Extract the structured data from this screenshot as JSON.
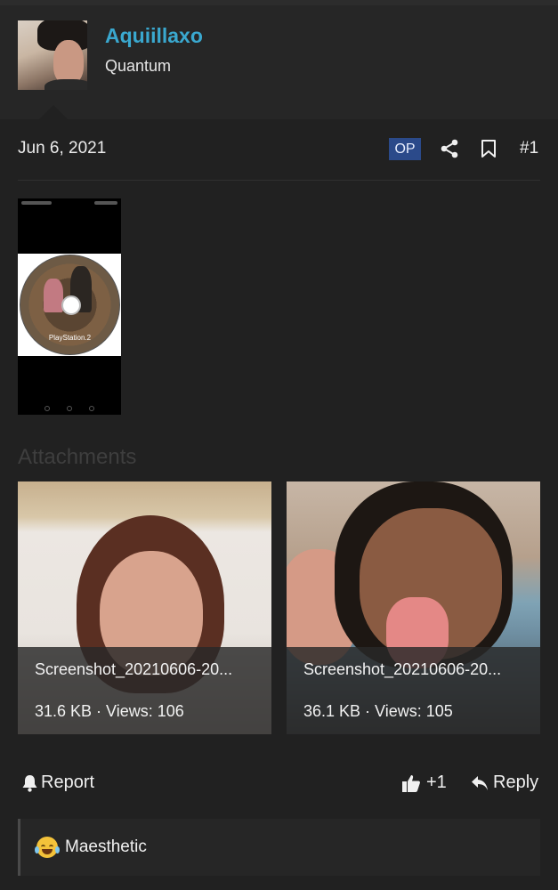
{
  "user": {
    "name": "Aquiillaxo",
    "title": "Quantum"
  },
  "post": {
    "date": "Jun 6, 2021",
    "op_badge": "OP",
    "number": "#1",
    "embedded_image_label": "PlayStation.2"
  },
  "attachments": {
    "heading": "Attachments",
    "items": [
      {
        "filename": "Screenshot_20210606-20...",
        "meta": "31.6 KB · Views: 106"
      },
      {
        "filename": "Screenshot_20210606-20...",
        "meta": "36.1 KB · Views: 105"
      }
    ]
  },
  "actions": {
    "report": "Report",
    "like": "+1",
    "reply": "Reply"
  },
  "reaction": {
    "text": "Maesthetic",
    "icon": "joy-tears-emoji"
  },
  "colors": {
    "background": "#212121",
    "username": "#3aa8cf",
    "op_badge": "#2b4a8a"
  }
}
